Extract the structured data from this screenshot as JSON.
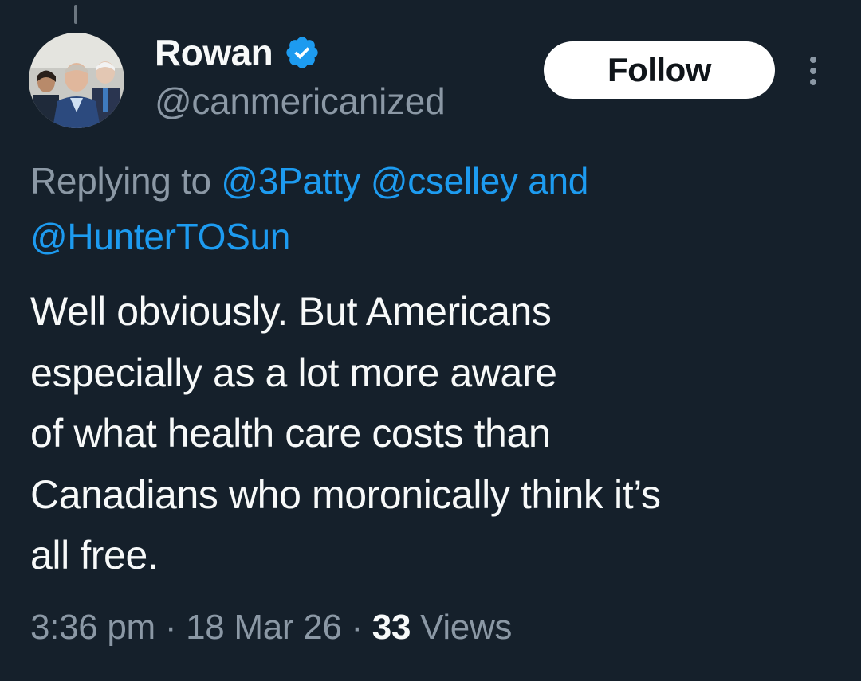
{
  "author": {
    "display_name": "Rowan",
    "handle": "@canmericanized",
    "verified": true,
    "verified_color": "#1d9bf0"
  },
  "actions": {
    "follow_label": "Follow",
    "more_icon": "more-vertical-icon"
  },
  "reply_context": {
    "prefix": "Replying to",
    "mentions": [
      "@3Patty",
      "@cselley",
      "@HunterTOSun"
    ],
    "conjunction": "and"
  },
  "tweet": {
    "lines": [
      "Well obviously. But Americans",
      "especially as a lot more aware",
      "of what health care costs than",
      "Canadians who moronically think it’s",
      "all free."
    ]
  },
  "meta": {
    "time": "3:36 pm",
    "separator": "·",
    "date": "18 Mar 26",
    "views_count": "33",
    "views_label": "Views"
  },
  "colors": {
    "background": "#15202b",
    "text_primary": "#f7f9f9",
    "text_secondary": "#8b98a5",
    "link": "#1d9bf0"
  }
}
